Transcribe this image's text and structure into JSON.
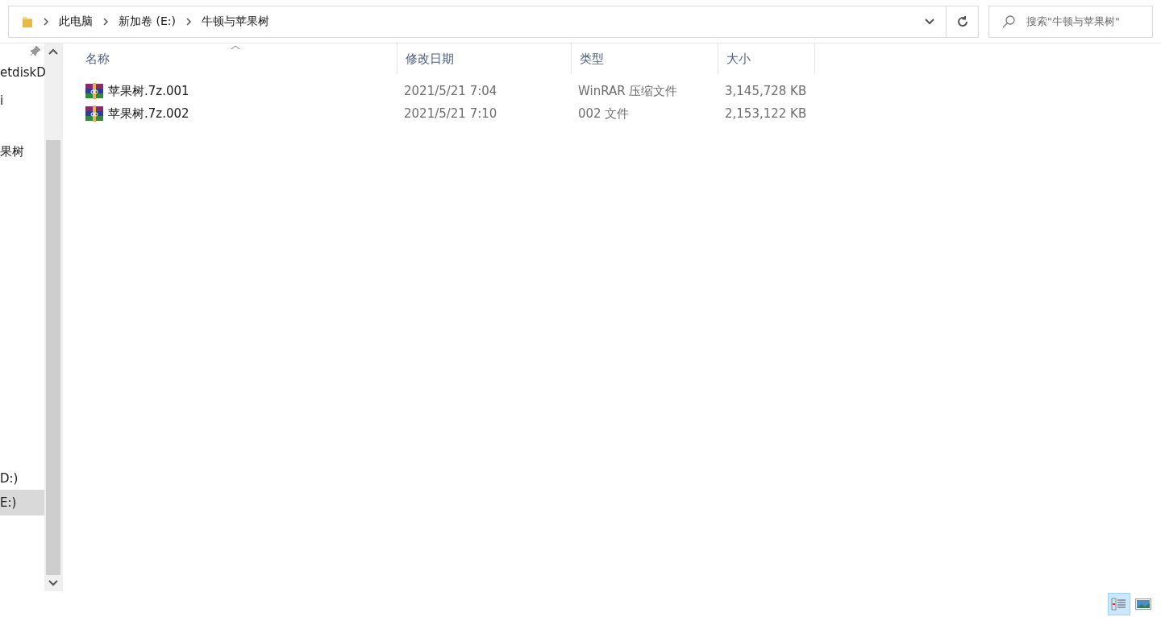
{
  "address_bar": {
    "breadcrumbs": [
      "此电脑",
      "新加卷 (E:)",
      "牛顿与苹果树"
    ]
  },
  "search": {
    "placeholder": "搜索\"牛顿与苹果树\""
  },
  "sidebar": {
    "items": [
      {
        "label": "etdiskD",
        "selected": false,
        "pinned": true
      },
      {
        "label": "i",
        "selected": false,
        "pinned": false
      },
      {
        "label": "果树",
        "selected": false,
        "pinned": false
      },
      {
        "label": "D:)",
        "selected": false,
        "pinned": false
      },
      {
        "label": "E:)",
        "selected": true,
        "pinned": false
      }
    ]
  },
  "table": {
    "columns": [
      {
        "label": "名称",
        "sorted": true
      },
      {
        "label": "修改日期",
        "sorted": false
      },
      {
        "label": "类型",
        "sorted": false
      },
      {
        "label": "大小",
        "sorted": false
      }
    ],
    "rows": [
      {
        "name": "苹果树.7z.001",
        "modified": "2021/5/21 7:04",
        "type": "WinRAR 压缩文件",
        "size": "3,145,728 KB"
      },
      {
        "name": "苹果树.7z.002",
        "modified": "2021/5/21 7:10",
        "type": "002 文件",
        "size": "2,153,122 KB"
      }
    ]
  },
  "status_bar": {
    "views": [
      {
        "kind": "details",
        "selected": true
      },
      {
        "kind": "thumbnails",
        "selected": false
      }
    ]
  }
}
